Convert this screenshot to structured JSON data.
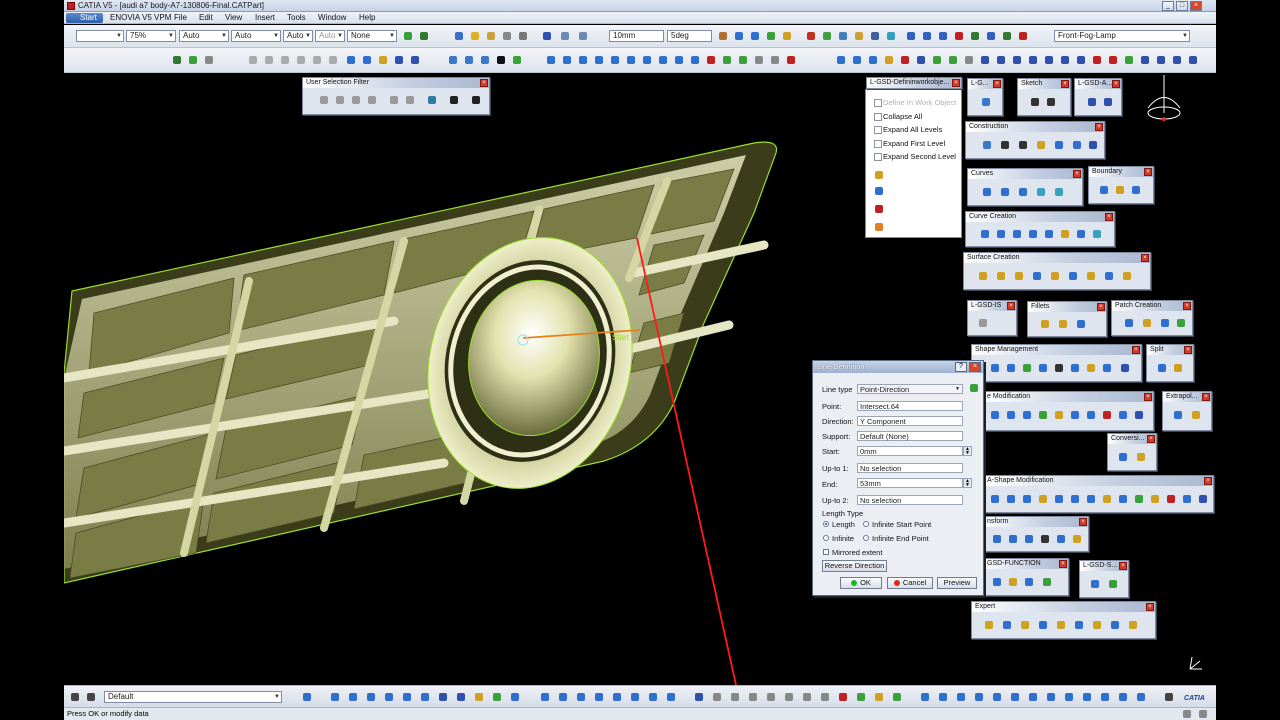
{
  "window": {
    "title": "CATIA V5 - [audi a7 body-A7-130806-Final.CATPart]",
    "min": "_",
    "max": "□",
    "close": "×"
  },
  "menubar": [
    "Start",
    "ENOVIA V5 VPM",
    "File",
    "Edit",
    "View",
    "Insert",
    "Tools",
    "Window",
    "Help"
  ],
  "toolbar": {
    "zoom": "75%",
    "auto1": "Auto",
    "auto2": "Auto",
    "auto3": "Auto",
    "auto4": "Auto",
    "layer": "None",
    "step_length": "10mm",
    "step_angle": "5deg",
    "geometrical_set": "Front-Fog-Lamp"
  },
  "floating_toolbars": {
    "user_selection_filter": "User Selection Filter",
    "lgsd_define": "L-GSD-Defininworkobje...",
    "lg": "L-G...",
    "sketch": "Sketch",
    "lgsd_a": "L-GSD-A...",
    "construction": "Construction",
    "curves": "Curves",
    "boundary": "Boundary",
    "curve_creation": "Curve Creation",
    "surface_creation": "Surface Creation",
    "lgsd_is": "L-GSD-IS",
    "fillets": "Fillets",
    "patch_creation": "Patch Creation",
    "shape_management": "Shape Management",
    "split": "Split",
    "shape_modification": "e Modification",
    "extrapol": "Extrapol...",
    "conversi": "Conversi...",
    "a_shape_modification": "A-Shape Modification",
    "transform": "nsform",
    "gsd_function": "GSD-FUNCTION",
    "lgsd_s": "L-GSD-S...",
    "expert": "Expert"
  },
  "tree_panel": {
    "items": [
      "Define In Work Object",
      "Collapse All",
      "Expand All Levels",
      "Expand First Level",
      "Expand Second Level"
    ]
  },
  "line_dialog": {
    "title": "Line Definition",
    "help": "?",
    "close": "×",
    "line_type_label": "Line type",
    "line_type_value": "Point-Direction",
    "point_label": "Point:",
    "point_value": "Intersect.64",
    "direction_label": "Direction:",
    "direction_value": "Y Component",
    "support_label": "Support:",
    "support_value": "Default (None)",
    "start_label": "Start:",
    "start_value": "0mm",
    "upto1_label": "Up-to 1:",
    "upto1_value": "No selection",
    "end_label": "End:",
    "end_value": "53mm",
    "upto2_label": "Up-to 2:",
    "upto2_value": "No selection",
    "length_type_label": "Length Type",
    "length": "Length",
    "infinite_start": "Infinite Start Point",
    "infinite": "Infinite",
    "infinite_end": "Infinite End Point",
    "mirrored": "Mirrored extent",
    "reverse": "Reverse Direction",
    "ok": "OK",
    "cancel": "Cancel",
    "preview": "Preview"
  },
  "viewport": {
    "start_label": "Start"
  },
  "bottom_toolbar": {
    "default_style": "Default"
  },
  "statusbar": {
    "text": "Press OK or modify data"
  },
  "logo": "CATIA",
  "colors": {
    "part": "#d9dba8",
    "edge": "#9adf2a",
    "line": "#ff1a1a",
    "accent": "#2d5ea8"
  }
}
